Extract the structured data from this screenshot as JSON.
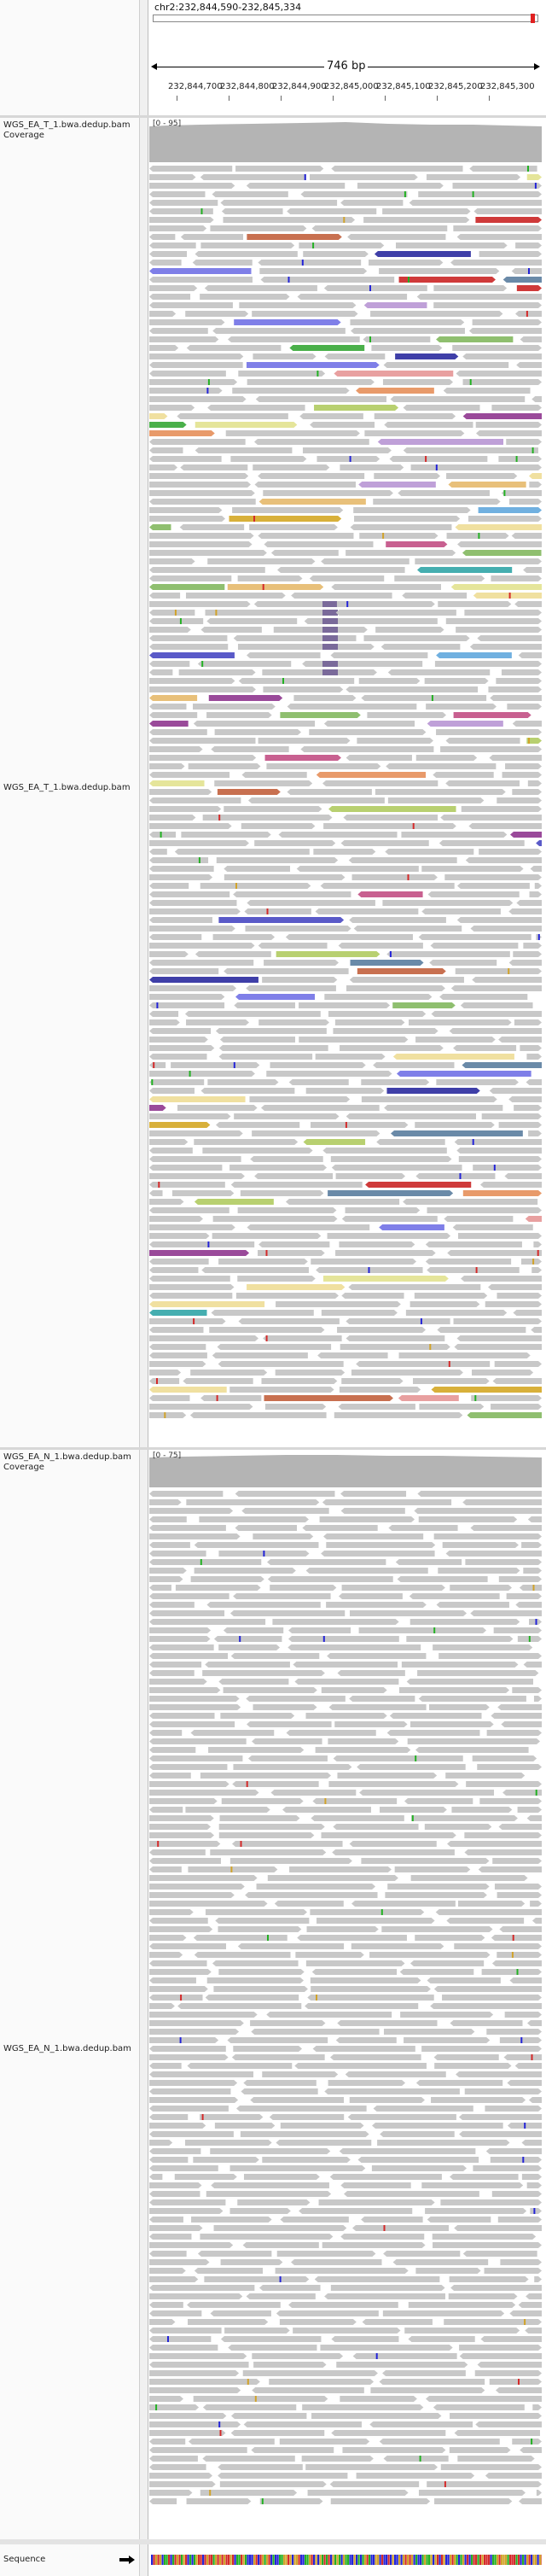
{
  "header": {
    "locus": "chr2:232,844,590-232,845,334",
    "span": "746 bp",
    "ticks": [
      "232,844,700",
      "232,844,800",
      "232,844,900",
      "232,845,000",
      "232,845,100",
      "232,845,200",
      "232,845,300"
    ]
  },
  "tracks": [
    {
      "id": "t-cov",
      "label": "WGS_EA_T_1.bwa.dedup.bam Coverage",
      "range": "[0 - 95]"
    },
    {
      "id": "t-reads",
      "label": "WGS_EA_T_1.bwa.dedup.bam"
    },
    {
      "id": "n-cov",
      "label": "WGS_EA_N_1.bwa.dedup.bam Coverage",
      "range": "[0 - 75]"
    },
    {
      "id": "n-reads",
      "label": "WGS_EA_N_1.bwa.dedup.bam"
    }
  ],
  "sequence": {
    "label": "Sequence",
    "arrow": "right-arrow-icon"
  },
  "colors": {
    "read": "#c8c8c8",
    "coverage": "#b4b4b4",
    "A": "#23b123",
    "C": "#2424d8",
    "G": "#d1a32a",
    "T": "#d42a2a"
  }
}
